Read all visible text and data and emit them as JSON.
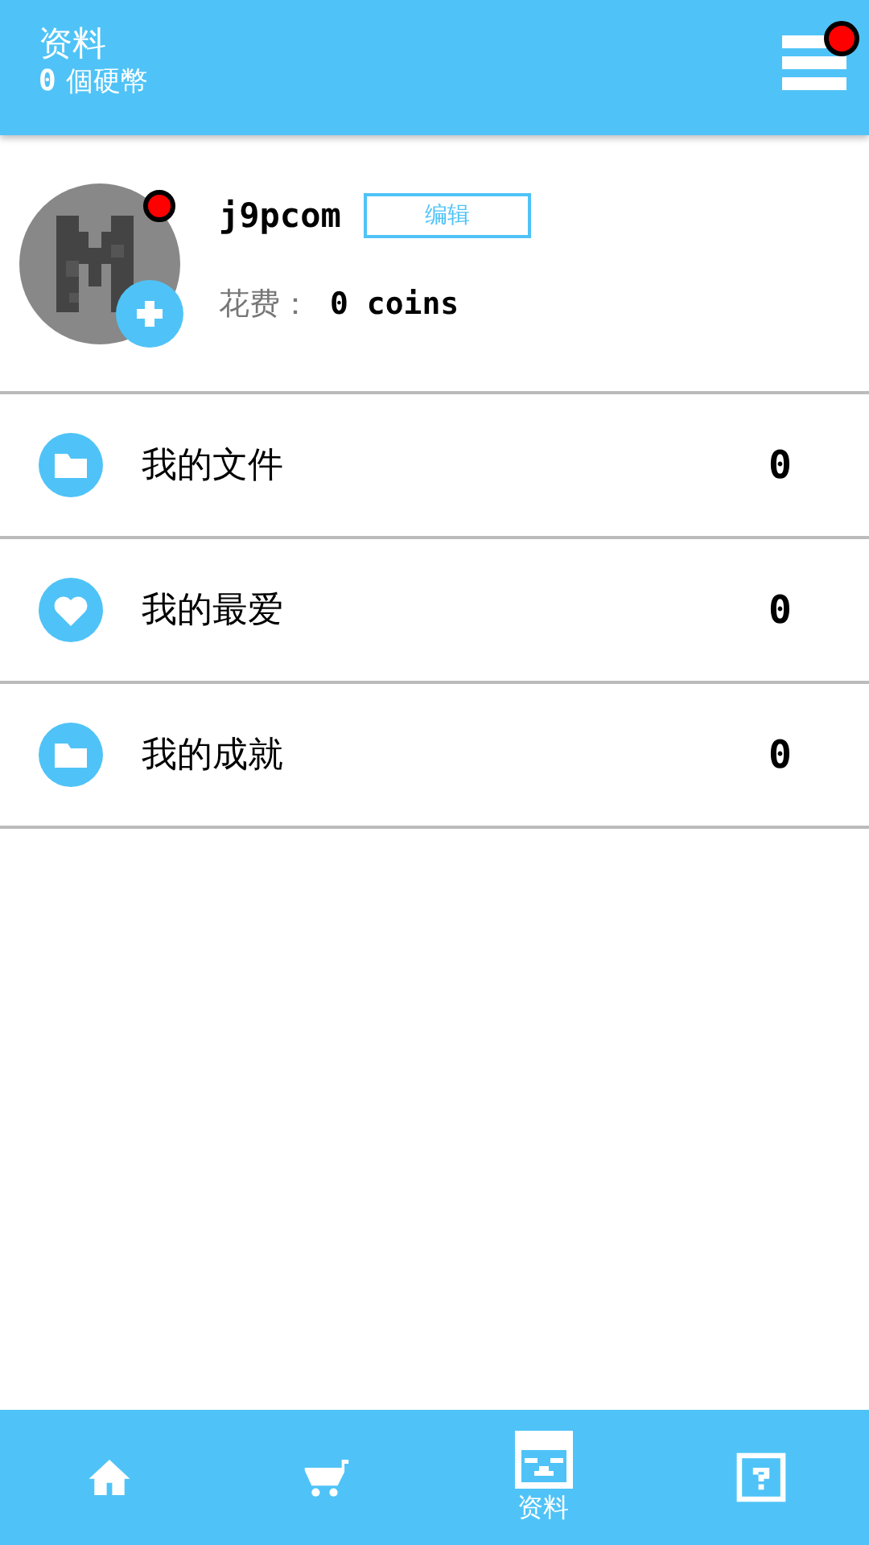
{
  "header": {
    "title": "资料",
    "coins": "0",
    "coins_label": "個硬幣",
    "menu_badge": true
  },
  "profile": {
    "username": "j9pcom",
    "edit_label": "编辑",
    "avatar_badge": true,
    "spent_label": "花费：",
    "spent_value": "0 coins"
  },
  "menu": [
    {
      "kind": "folder",
      "label": "我的文件",
      "count": "0"
    },
    {
      "kind": "heart",
      "label": "我的最爱",
      "count": "0"
    },
    {
      "kind": "folder",
      "label": "我的成就",
      "count": "0"
    }
  ],
  "nav": [
    {
      "kind": "home",
      "selected": false
    },
    {
      "kind": "cart",
      "selected": false
    },
    {
      "kind": "profile",
      "label": "资料",
      "selected": true
    },
    {
      "kind": "help",
      "selected": false
    }
  ]
}
